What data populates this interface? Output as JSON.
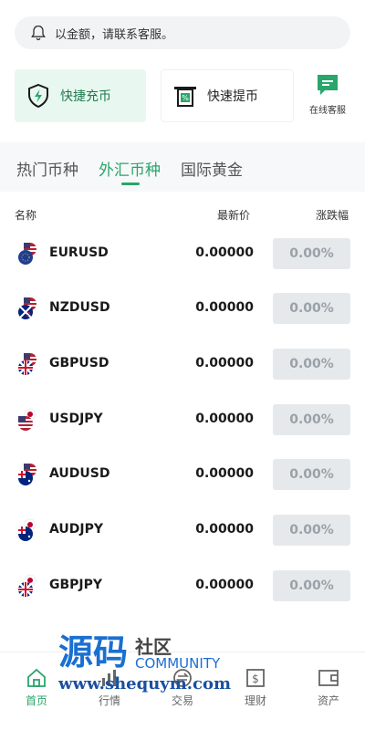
{
  "notice": {
    "text": "以金额，请联系客服。"
  },
  "quick_actions": {
    "deposit": "快捷充币",
    "withdraw": "快速提币"
  },
  "service": {
    "label": "在线客服"
  },
  "tabs": [
    "热门币种",
    "外汇币种",
    "国际黄金"
  ],
  "active_tab": 1,
  "table": {
    "headers": {
      "name": "名称",
      "price": "最新价",
      "change": "涨跌幅"
    },
    "rows": [
      {
        "symbol": "EURUSD",
        "price": "0.00000",
        "change": "0.00%"
      },
      {
        "symbol": "NZDUSD",
        "price": "0.00000",
        "change": "0.00%"
      },
      {
        "symbol": "GBPUSD",
        "price": "0.00000",
        "change": "0.00%"
      },
      {
        "symbol": "USDJPY",
        "price": "0.00000",
        "change": "0.00%"
      },
      {
        "symbol": "AUDUSD",
        "price": "0.00000",
        "change": "0.00%"
      },
      {
        "symbol": "AUDJPY",
        "price": "0.00000",
        "change": "0.00%"
      },
      {
        "symbol": "GBPJPY",
        "price": "0.00000",
        "change": "0.00%"
      }
    ]
  },
  "watermark": {
    "title": "源码",
    "sub1": "社区",
    "sub2": "COMMUNITY",
    "url": "www.shequym.com"
  },
  "nav": [
    "首页",
    "行情",
    "交易",
    "理财",
    "资产"
  ],
  "colors": {
    "accent": "#2aa56b",
    "deposit_bg": "#e8f8f0",
    "change_bg": "#e6e9ec"
  }
}
